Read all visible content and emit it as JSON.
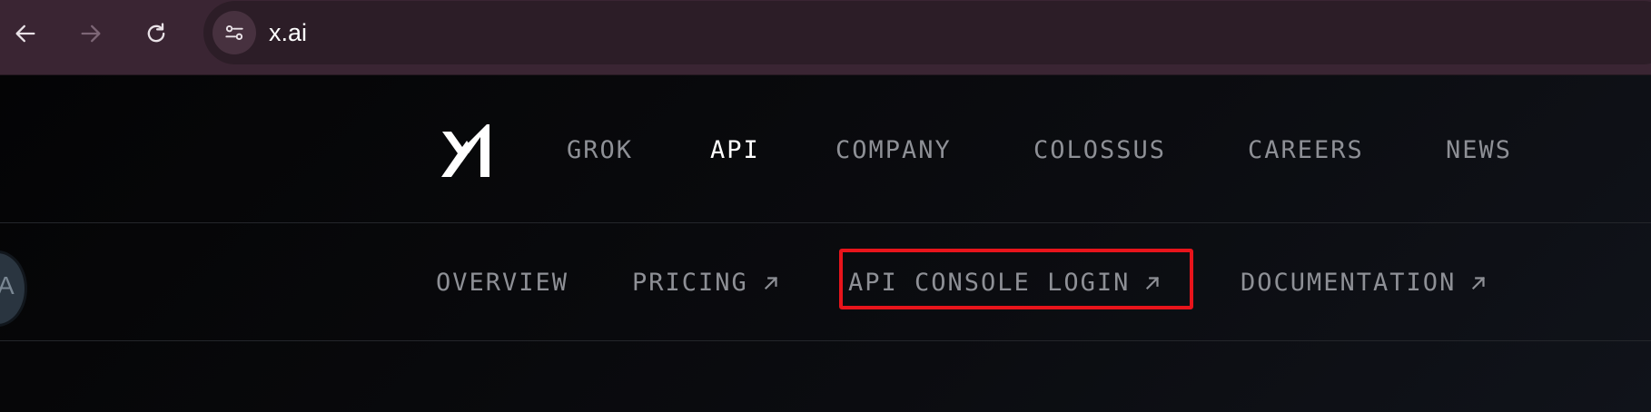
{
  "browser": {
    "url": "x.ai"
  },
  "main_nav": {
    "items": [
      {
        "label": "GROK",
        "active": false
      },
      {
        "label": "API",
        "active": true
      },
      {
        "label": "COMPANY",
        "active": false
      },
      {
        "label": "COLOSSUS",
        "active": false
      },
      {
        "label": "CAREERS",
        "active": false
      },
      {
        "label": "NEWS",
        "active": false
      }
    ]
  },
  "sub_nav": {
    "items": [
      {
        "label": "OVERVIEW",
        "external": false
      },
      {
        "label": "PRICING",
        "external": true
      },
      {
        "label": "API CONSOLE LOGIN",
        "external": true,
        "highlighted": true
      },
      {
        "label": "DOCUMENTATION",
        "external": true
      }
    ]
  },
  "side_widget": {
    "glyph": "A"
  },
  "colors": {
    "highlight": "#e8141b",
    "chrome": "#3a2533",
    "background": "#08090b"
  }
}
